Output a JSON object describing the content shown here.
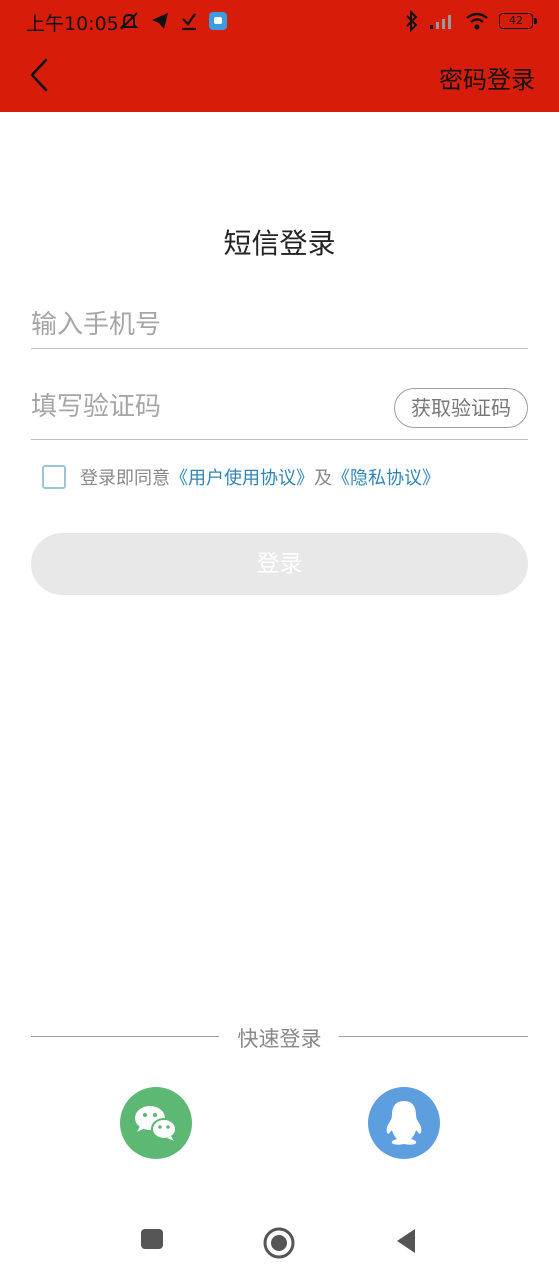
{
  "status_bar": {
    "time": "上午10:05",
    "battery": "42",
    "left_icons": [
      "mute-icon",
      "telegram-icon",
      "download-icon",
      "app-notification-icon"
    ],
    "right_icons": [
      "bluetooth-icon",
      "signal-icon",
      "wifi-icon",
      "battery-icon"
    ]
  },
  "header": {
    "bg_color": "#d71c0a",
    "back_icon": "chevron-left-icon",
    "right_action": "密码登录"
  },
  "page_title": "短信登录",
  "form": {
    "phone_placeholder": "输入手机号",
    "code_placeholder": "填写验证码",
    "get_code": "获取验证码"
  },
  "agreement": {
    "prefix": "登录即同意",
    "user_agreement": "《用户使用协议》",
    "connector": "及",
    "privacy": "《隐私协议》"
  },
  "login_button": "登录",
  "quick_login": {
    "label": "快速登录",
    "options": [
      "wechat-icon",
      "qq-icon"
    ]
  },
  "nav_bar": [
    "recents-icon",
    "home-icon",
    "back-icon"
  ]
}
